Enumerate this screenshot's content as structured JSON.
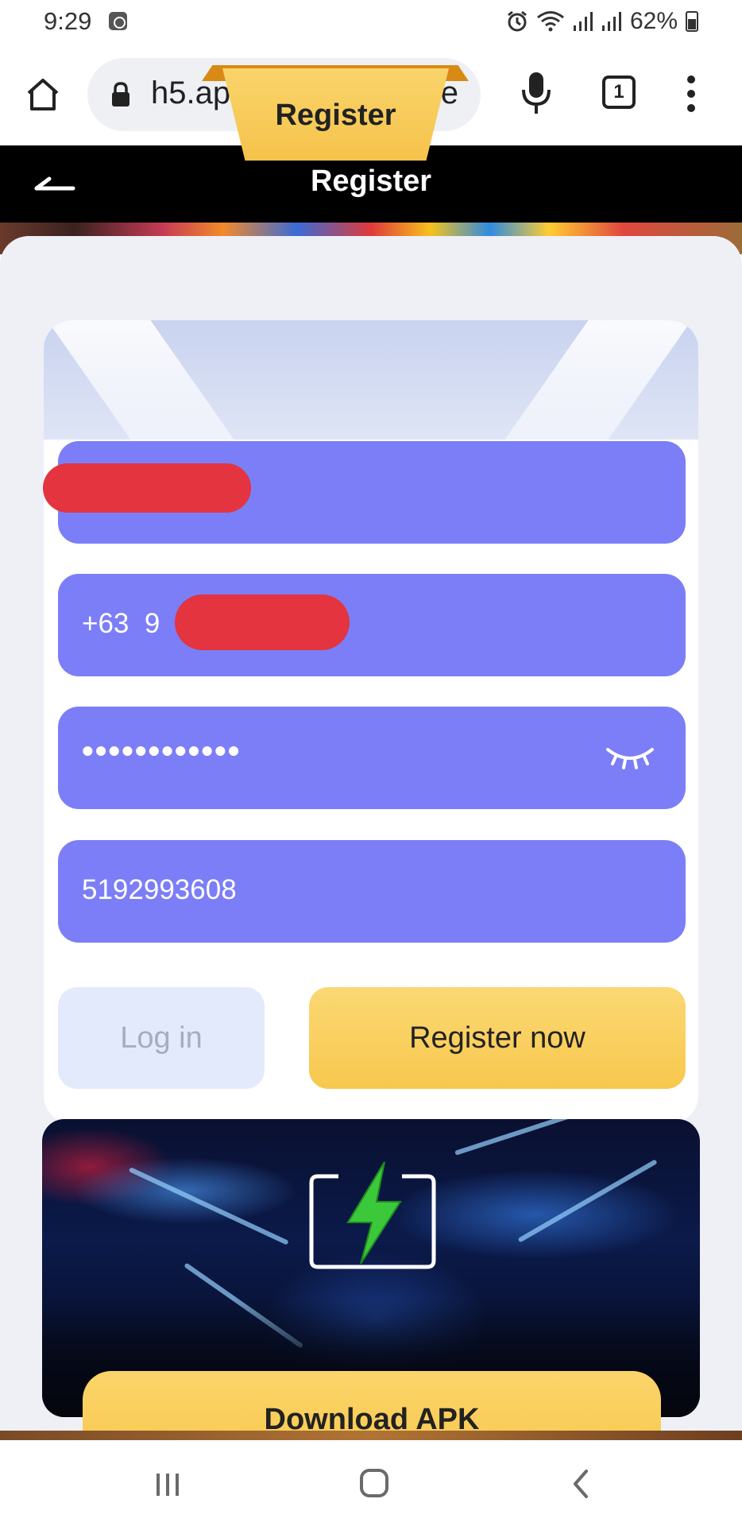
{
  "status_bar": {
    "time": "9:29",
    "battery_percent": "62%"
  },
  "browser": {
    "url": "h5.apower.pro/#/page",
    "tab_count": "1"
  },
  "header": {
    "title": "Register"
  },
  "form": {
    "tab_title": "Register",
    "phone_prefix": "+63",
    "phone_partial": "9",
    "password_masked": "••••••••••••",
    "invite_code": "5192993608",
    "login_label": "Log in",
    "register_label": "Register now"
  },
  "promo": {
    "download_label": "Download APK"
  },
  "colors": {
    "field_bg": "#7c7ef7",
    "register_btn": "#f8c84d",
    "login_btn": "#e3eafb",
    "header_bg": "#000000",
    "redaction": "#e3343f"
  },
  "icons": {
    "home": "home-icon",
    "lock": "lock-icon",
    "mic": "mic-icon",
    "tabs": "tabs-icon",
    "menu": "more-vert-icon",
    "back": "back-arrow-icon",
    "eye": "eye-closed-icon",
    "bolt": "lightning-bolt-icon"
  }
}
